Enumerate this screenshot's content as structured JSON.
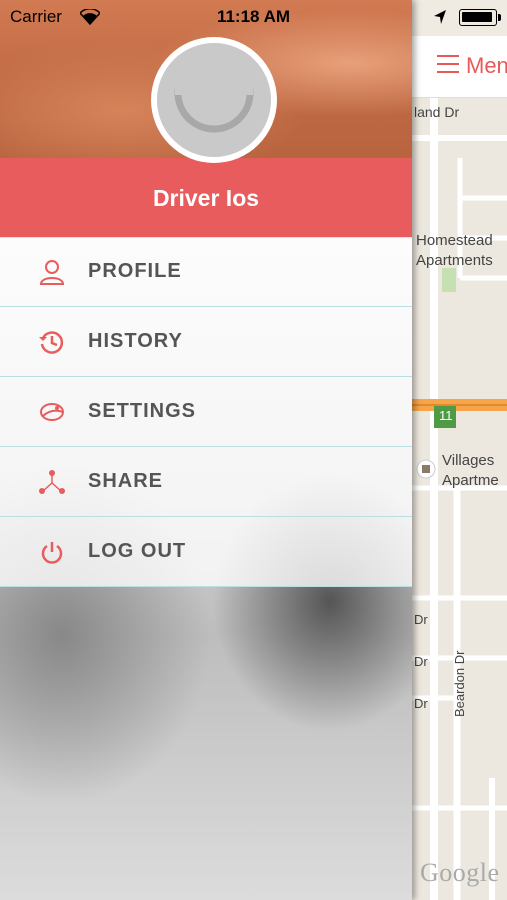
{
  "status_bar": {
    "carrier": "Carrier",
    "time": "11:18 AM",
    "wifi_icon": "wifi-icon",
    "location_icon": "location-arrow-icon",
    "battery_icon": "battery-icon"
  },
  "drawer": {
    "user_name": "Driver Ios",
    "avatar_icon": "avatar-placeholder-icon",
    "accent_color": "#e85c5e",
    "divider_color": "#b9dfe0",
    "items": [
      {
        "label": "PROFILE",
        "icon": "user-icon"
      },
      {
        "label": "HISTORY",
        "icon": "history-clock-icon"
      },
      {
        "label": "SETTINGS",
        "icon": "settings-icon"
      },
      {
        "label": "SHARE",
        "icon": "share-icon"
      },
      {
        "label": "LOG OUT",
        "icon": "power-icon"
      }
    ]
  },
  "map": {
    "menu_label": "Menu",
    "menu_icon": "hamburger-icon",
    "labels": [
      "land Dr",
      "Homestead",
      "Apartments",
      "11",
      "Villages",
      "Apartme",
      "Dr",
      "Dr",
      "Dr",
      "Beardon Dr"
    ],
    "attribution": "Google"
  }
}
